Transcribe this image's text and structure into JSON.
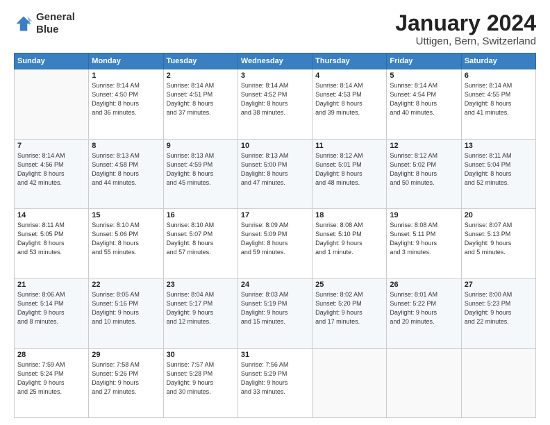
{
  "header": {
    "logo_line1": "General",
    "logo_line2": "Blue",
    "title": "January 2024",
    "subtitle": "Uttigen, Bern, Switzerland"
  },
  "calendar": {
    "days_of_week": [
      "Sunday",
      "Monday",
      "Tuesday",
      "Wednesday",
      "Thursday",
      "Friday",
      "Saturday"
    ],
    "weeks": [
      [
        {
          "day": "",
          "info": ""
        },
        {
          "day": "1",
          "info": "Sunrise: 8:14 AM\nSunset: 4:50 PM\nDaylight: 8 hours\nand 36 minutes."
        },
        {
          "day": "2",
          "info": "Sunrise: 8:14 AM\nSunset: 4:51 PM\nDaylight: 8 hours\nand 37 minutes."
        },
        {
          "day": "3",
          "info": "Sunrise: 8:14 AM\nSunset: 4:52 PM\nDaylight: 8 hours\nand 38 minutes."
        },
        {
          "day": "4",
          "info": "Sunrise: 8:14 AM\nSunset: 4:53 PM\nDaylight: 8 hours\nand 39 minutes."
        },
        {
          "day": "5",
          "info": "Sunrise: 8:14 AM\nSunset: 4:54 PM\nDaylight: 8 hours\nand 40 minutes."
        },
        {
          "day": "6",
          "info": "Sunrise: 8:14 AM\nSunset: 4:55 PM\nDaylight: 8 hours\nand 41 minutes."
        }
      ],
      [
        {
          "day": "7",
          "info": "Sunrise: 8:14 AM\nSunset: 4:56 PM\nDaylight: 8 hours\nand 42 minutes."
        },
        {
          "day": "8",
          "info": "Sunrise: 8:13 AM\nSunset: 4:58 PM\nDaylight: 8 hours\nand 44 minutes."
        },
        {
          "day": "9",
          "info": "Sunrise: 8:13 AM\nSunset: 4:59 PM\nDaylight: 8 hours\nand 45 minutes."
        },
        {
          "day": "10",
          "info": "Sunrise: 8:13 AM\nSunset: 5:00 PM\nDaylight: 8 hours\nand 47 minutes."
        },
        {
          "day": "11",
          "info": "Sunrise: 8:12 AM\nSunset: 5:01 PM\nDaylight: 8 hours\nand 48 minutes."
        },
        {
          "day": "12",
          "info": "Sunrise: 8:12 AM\nSunset: 5:02 PM\nDaylight: 8 hours\nand 50 minutes."
        },
        {
          "day": "13",
          "info": "Sunrise: 8:11 AM\nSunset: 5:04 PM\nDaylight: 8 hours\nand 52 minutes."
        }
      ],
      [
        {
          "day": "14",
          "info": "Sunrise: 8:11 AM\nSunset: 5:05 PM\nDaylight: 8 hours\nand 53 minutes."
        },
        {
          "day": "15",
          "info": "Sunrise: 8:10 AM\nSunset: 5:06 PM\nDaylight: 8 hours\nand 55 minutes."
        },
        {
          "day": "16",
          "info": "Sunrise: 8:10 AM\nSunset: 5:07 PM\nDaylight: 8 hours\nand 57 minutes."
        },
        {
          "day": "17",
          "info": "Sunrise: 8:09 AM\nSunset: 5:09 PM\nDaylight: 8 hours\nand 59 minutes."
        },
        {
          "day": "18",
          "info": "Sunrise: 8:08 AM\nSunset: 5:10 PM\nDaylight: 9 hours\nand 1 minute."
        },
        {
          "day": "19",
          "info": "Sunrise: 8:08 AM\nSunset: 5:11 PM\nDaylight: 9 hours\nand 3 minutes."
        },
        {
          "day": "20",
          "info": "Sunrise: 8:07 AM\nSunset: 5:13 PM\nDaylight: 9 hours\nand 5 minutes."
        }
      ],
      [
        {
          "day": "21",
          "info": "Sunrise: 8:06 AM\nSunset: 5:14 PM\nDaylight: 9 hours\nand 8 minutes."
        },
        {
          "day": "22",
          "info": "Sunrise: 8:05 AM\nSunset: 5:16 PM\nDaylight: 9 hours\nand 10 minutes."
        },
        {
          "day": "23",
          "info": "Sunrise: 8:04 AM\nSunset: 5:17 PM\nDaylight: 9 hours\nand 12 minutes."
        },
        {
          "day": "24",
          "info": "Sunrise: 8:03 AM\nSunset: 5:19 PM\nDaylight: 9 hours\nand 15 minutes."
        },
        {
          "day": "25",
          "info": "Sunrise: 8:02 AM\nSunset: 5:20 PM\nDaylight: 9 hours\nand 17 minutes."
        },
        {
          "day": "26",
          "info": "Sunrise: 8:01 AM\nSunset: 5:22 PM\nDaylight: 9 hours\nand 20 minutes."
        },
        {
          "day": "27",
          "info": "Sunrise: 8:00 AM\nSunset: 5:23 PM\nDaylight: 9 hours\nand 22 minutes."
        }
      ],
      [
        {
          "day": "28",
          "info": "Sunrise: 7:59 AM\nSunset: 5:24 PM\nDaylight: 9 hours\nand 25 minutes."
        },
        {
          "day": "29",
          "info": "Sunrise: 7:58 AM\nSunset: 5:26 PM\nDaylight: 9 hours\nand 27 minutes."
        },
        {
          "day": "30",
          "info": "Sunrise: 7:57 AM\nSunset: 5:28 PM\nDaylight: 9 hours\nand 30 minutes."
        },
        {
          "day": "31",
          "info": "Sunrise: 7:56 AM\nSunset: 5:29 PM\nDaylight: 9 hours\nand 33 minutes."
        },
        {
          "day": "",
          "info": ""
        },
        {
          "day": "",
          "info": ""
        },
        {
          "day": "",
          "info": ""
        }
      ]
    ]
  }
}
